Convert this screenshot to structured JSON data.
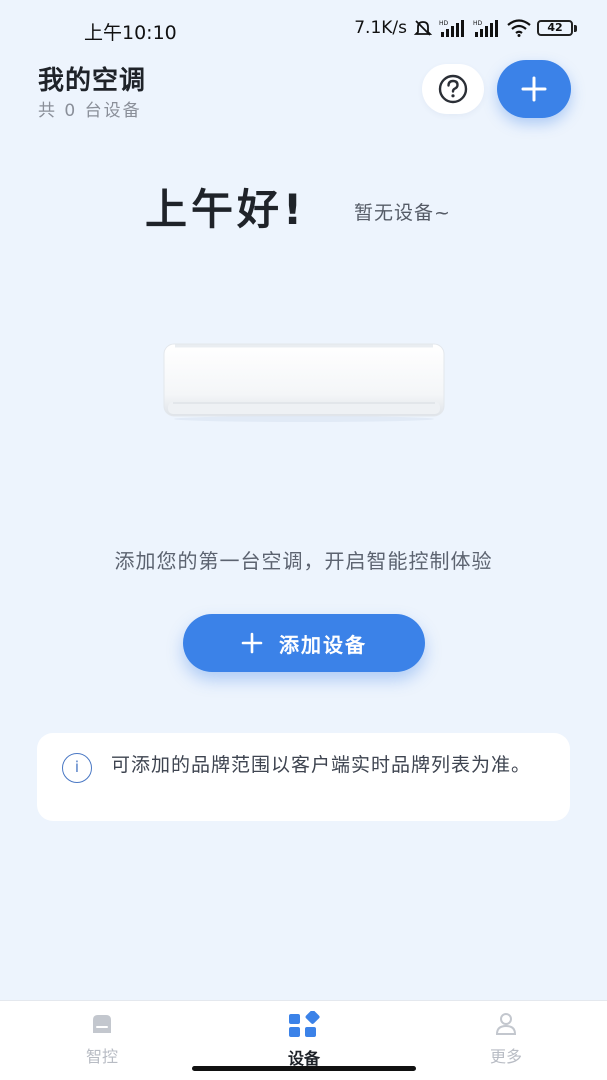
{
  "status_bar": {
    "time": "上午10:10",
    "network_speed": "7.1K/s",
    "signal_label": "HD",
    "battery": "42"
  },
  "header": {
    "title": "我的空调",
    "device_count": "共 0 台设备"
  },
  "hero": {
    "greeting": "上午好!",
    "no_device": "暂无设备~"
  },
  "main": {
    "invite_text": "添加您的第一台空调，开启智能控制体验",
    "add_device_label": "添加设备",
    "notice_icon": "i",
    "notice_text": "可添加的品牌范围以客户端实时品牌列表为准。"
  },
  "bottom_nav": {
    "items": [
      {
        "label": "智控",
        "icon": "router-icon",
        "active": false
      },
      {
        "label": "设备",
        "icon": "grid-icon",
        "active": true
      },
      {
        "label": "更多",
        "icon": "person-icon",
        "active": false
      }
    ]
  },
  "colors": {
    "accent": "#3b82e8",
    "background": "#edf4fd",
    "inactive": "#b8bcc4"
  }
}
